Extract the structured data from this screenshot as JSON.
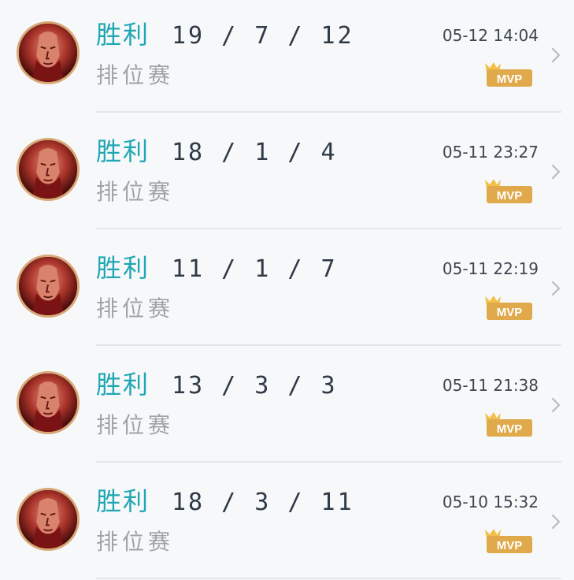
{
  "matches": [
    {
      "result": "胜利",
      "kda": "19 / 7 / 12",
      "mode": "排位赛",
      "time": "05-12 14:04",
      "badge": "MVP"
    },
    {
      "result": "胜利",
      "kda": "18 / 1 / 4",
      "mode": "排位赛",
      "time": "05-11 23:27",
      "badge": "MVP"
    },
    {
      "result": "胜利",
      "kda": "11 / 1 / 7",
      "mode": "排位赛",
      "time": "05-11 22:19",
      "badge": "MVP"
    },
    {
      "result": "胜利",
      "kda": "13 / 3 / 3",
      "mode": "排位赛",
      "time": "05-11 21:38",
      "badge": "MVP"
    },
    {
      "result": "胜利",
      "kda": "18 / 3 / 11",
      "mode": "排位赛",
      "time": "05-10 15:32",
      "badge": "MVP"
    }
  ],
  "colors": {
    "result": "#1ea7b3",
    "kda": "#2e3a46",
    "mode": "#9ea3a8",
    "badge": "#e0a94b",
    "avatar_frame": "#d8a877"
  },
  "icons": {
    "avatar": "hero-portrait-icon",
    "badge": "mvp-badge-icon",
    "row_action": "chevron-right-icon"
  }
}
